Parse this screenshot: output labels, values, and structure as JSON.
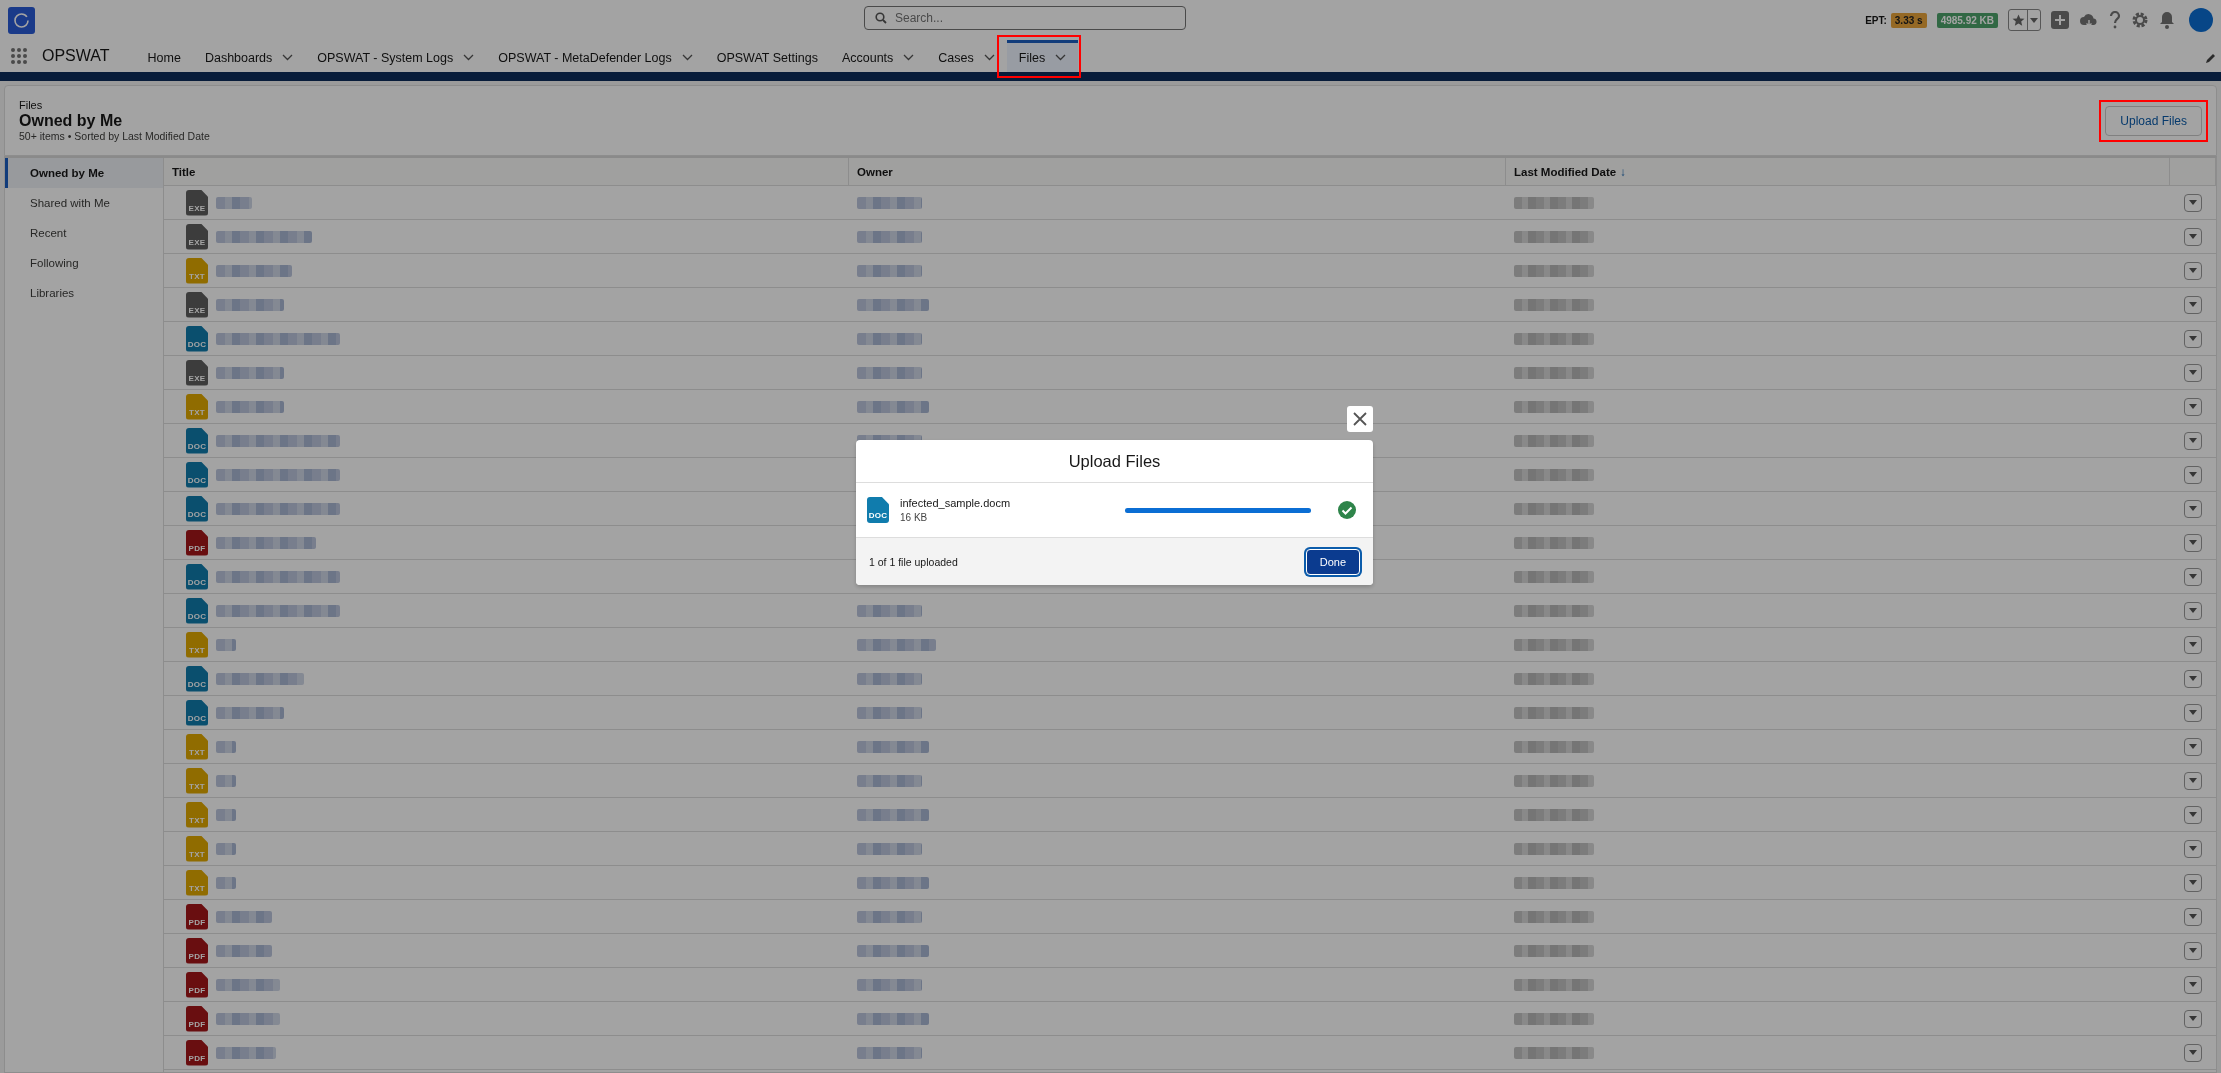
{
  "global_header": {
    "search": {
      "placeholder": "Search..."
    },
    "ept_label": "EPT:",
    "ept_value": "3.33 s",
    "size_value": "4985.92 KB"
  },
  "nav": {
    "app_name": "OPSWAT",
    "items": [
      {
        "label": "Home",
        "has_menu": false,
        "selected": false,
        "highlighted": false
      },
      {
        "label": "Dashboards",
        "has_menu": true,
        "selected": false,
        "highlighted": false
      },
      {
        "label": "OPSWAT - System Logs",
        "has_menu": true,
        "selected": false,
        "highlighted": false
      },
      {
        "label": "OPSWAT - MetaDefender Logs",
        "has_menu": true,
        "selected": false,
        "highlighted": false
      },
      {
        "label": "OPSWAT Settings",
        "has_menu": false,
        "selected": false,
        "highlighted": false
      },
      {
        "label": "Accounts",
        "has_menu": true,
        "selected": false,
        "highlighted": false
      },
      {
        "label": "Cases",
        "has_menu": true,
        "selected": false,
        "highlighted": false
      },
      {
        "label": "Files",
        "has_menu": true,
        "selected": true,
        "highlighted": true
      }
    ]
  },
  "page_header": {
    "object": "Files",
    "title": "Owned by Me",
    "subtitle": "50+ items • Sorted by Last Modified Date",
    "upload_button": {
      "label": "Upload Files",
      "highlighted": true
    }
  },
  "sidebar": {
    "items": [
      {
        "label": "Owned by Me",
        "selected": true
      },
      {
        "label": "Shared with Me",
        "selected": false
      },
      {
        "label": "Recent",
        "selected": false
      },
      {
        "label": "Following",
        "selected": false
      },
      {
        "label": "Libraries",
        "selected": false
      }
    ]
  },
  "table": {
    "columns": [
      {
        "label": "Title"
      },
      {
        "label": "Owner"
      },
      {
        "label": "Last Modified Date",
        "sort_indicator": "↓"
      }
    ],
    "rows": [
      {
        "kind": "exe",
        "icon_label": "EXE"
      },
      {
        "kind": "exe",
        "icon_label": "EXE"
      },
      {
        "kind": "txt",
        "icon_label": "TXT"
      },
      {
        "kind": "exe",
        "icon_label": "EXE"
      },
      {
        "kind": "doc",
        "icon_label": "DOC"
      },
      {
        "kind": "exe",
        "icon_label": "EXE"
      },
      {
        "kind": "txt",
        "icon_label": "TXT"
      },
      {
        "kind": "doc",
        "icon_label": "DOC"
      },
      {
        "kind": "doc",
        "icon_label": "DOC"
      },
      {
        "kind": "doc",
        "icon_label": "DOC"
      },
      {
        "kind": "pdf",
        "icon_label": "PDF"
      },
      {
        "kind": "doc",
        "icon_label": "DOC"
      },
      {
        "kind": "doc",
        "icon_label": "DOC"
      },
      {
        "kind": "txt",
        "icon_label": "TXT"
      },
      {
        "kind": "doc",
        "icon_label": "DOC"
      },
      {
        "kind": "doc",
        "icon_label": "DOC"
      },
      {
        "kind": "txt",
        "icon_label": "TXT"
      },
      {
        "kind": "txt",
        "icon_label": "TXT"
      },
      {
        "kind": "txt",
        "icon_label": "TXT"
      },
      {
        "kind": "txt",
        "icon_label": "TXT"
      },
      {
        "kind": "txt",
        "icon_label": "TXT"
      },
      {
        "kind": "pdf",
        "icon_label": "PDF"
      },
      {
        "kind": "pdf",
        "icon_label": "PDF"
      },
      {
        "kind": "pdf",
        "icon_label": "PDF"
      },
      {
        "kind": "pdf",
        "icon_label": "PDF"
      },
      {
        "kind": "pdf",
        "icon_label": "PDF"
      }
    ]
  },
  "modal": {
    "title": "Upload Files",
    "file": {
      "name": "infected_sample.docm",
      "size": "16 KB",
      "kind": "doc",
      "icon_label": "DOC",
      "level": 1,
      "done": true
    },
    "status": "1 of 1 file uploaded",
    "done_button": "Done"
  }
}
